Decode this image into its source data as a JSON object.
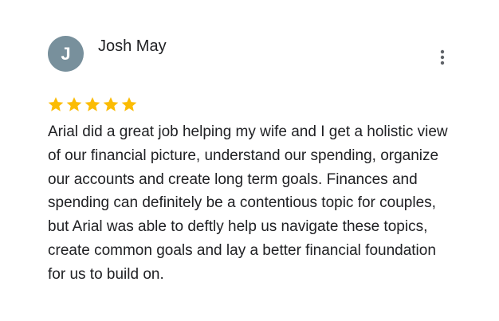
{
  "review": {
    "reviewer": {
      "name": "Josh May",
      "avatar_initial": "J",
      "avatar_color": "#78909c"
    },
    "rating": {
      "stars": 5,
      "max": 5,
      "star_color": "#fbbc04"
    },
    "menu_icon": "more-vertical-icon",
    "text": "Arial did a great job helping my wife and I get a holistic view of our financial picture, understand our spending, organize our accounts and create long term goals. Finances and spending can definitely be a contentious topic for couples, but Arial was able to deftly help us navigate these topics, create common goals and lay a better financial foundation for us to build on."
  }
}
